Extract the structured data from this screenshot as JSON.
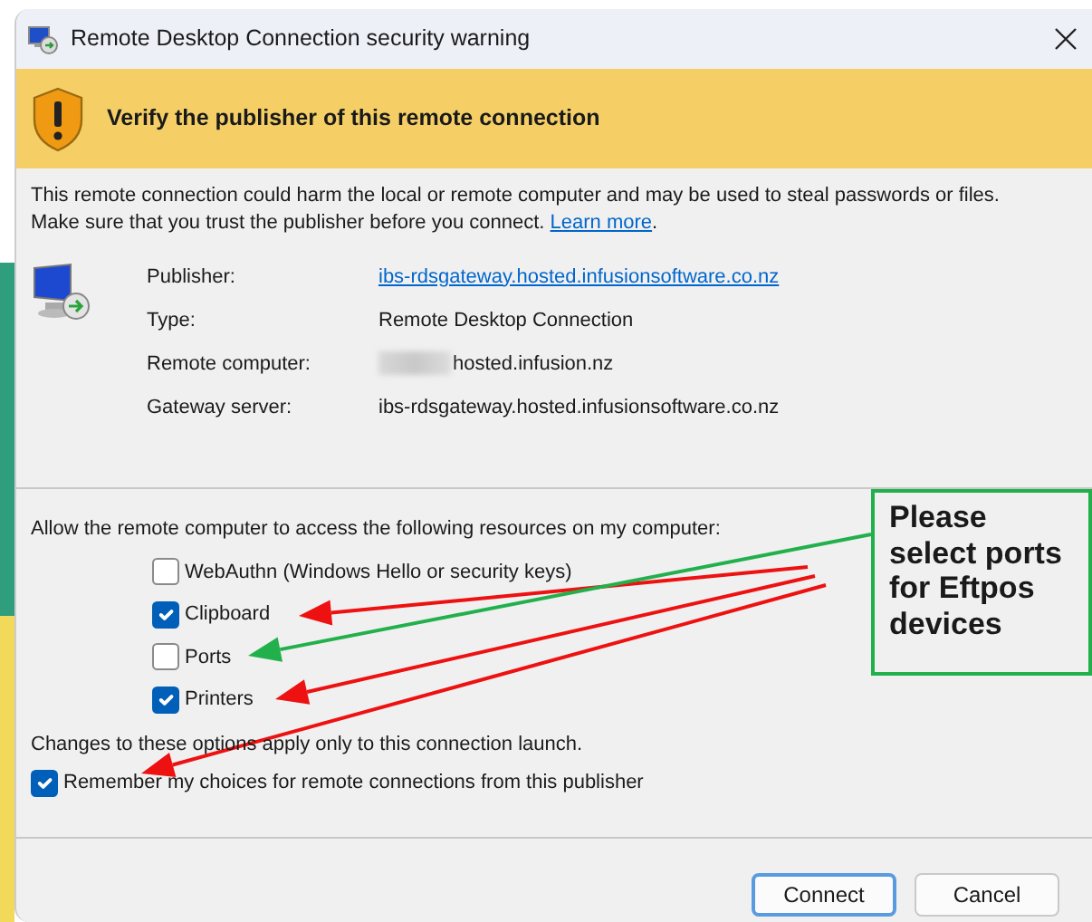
{
  "window": {
    "title": "Remote Desktop Connection security warning"
  },
  "banner": {
    "title": "Verify the publisher of this remote connection"
  },
  "message": {
    "text": "This remote connection could harm the local or remote computer and may be used to steal passwords or files. Make sure that you trust the publisher before you connect.",
    "link": "Learn more",
    "end": "."
  },
  "details": [
    {
      "label": "Publisher:",
      "value": "ibs-rdsgateway.hosted.infusionsoftware.co.nz",
      "kind": "link"
    },
    {
      "label": "Type:",
      "value": "Remote Desktop Connection",
      "kind": "text"
    },
    {
      "label": "Remote computer:",
      "value": "hosted.infusion.nz",
      "kind": "redacted"
    },
    {
      "label": "Gateway server:",
      "value": "ibs-rdsgateway.hosted.infusionsoftware.co.nz",
      "kind": "text"
    }
  ],
  "resources_prompt": "Allow the remote computer to access the following resources on my computer:",
  "resources": [
    {
      "label": "WebAuthn (Windows Hello or security keys)",
      "checked": false
    },
    {
      "label": "Clipboard",
      "checked": true
    },
    {
      "label": "Ports",
      "checked": false
    },
    {
      "label": "Printers",
      "checked": true
    }
  ],
  "note": "Changes to these options apply only to this connection launch.",
  "remember": {
    "label": "Remember my choices for remote connections from this publisher",
    "checked": true
  },
  "buttons": [
    {
      "label": "Connect",
      "default": true
    },
    {
      "label": "Cancel",
      "default": false
    }
  ],
  "annotation": {
    "text": "Please select ports for Eftpos devices",
    "arrows": [
      {
        "color": "#ee1111"
      },
      {
        "color": "#ee1111"
      },
      {
        "color": "#ee1111"
      },
      {
        "color": "#22b04c"
      }
    ]
  }
}
